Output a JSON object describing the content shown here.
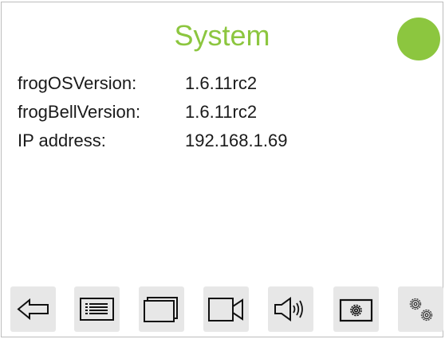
{
  "page": {
    "title": "System",
    "status_color": "#8cc63f",
    "title_color": "#8cc63f"
  },
  "info": [
    {
      "label": "frogOSVersion:",
      "value": "1.6.11rc2"
    },
    {
      "label": "frogBellVersion:",
      "value": "1.6.11rc2"
    },
    {
      "label": "IP address:",
      "value": "192.168.1.69"
    }
  ],
  "toolbar": [
    {
      "icon": "back-arrow-icon"
    },
    {
      "icon": "list-icon"
    },
    {
      "icon": "windows-icon"
    },
    {
      "icon": "video-camera-icon"
    },
    {
      "icon": "speaker-icon"
    },
    {
      "icon": "settings-icon"
    },
    {
      "icon": "gears-icon"
    }
  ]
}
